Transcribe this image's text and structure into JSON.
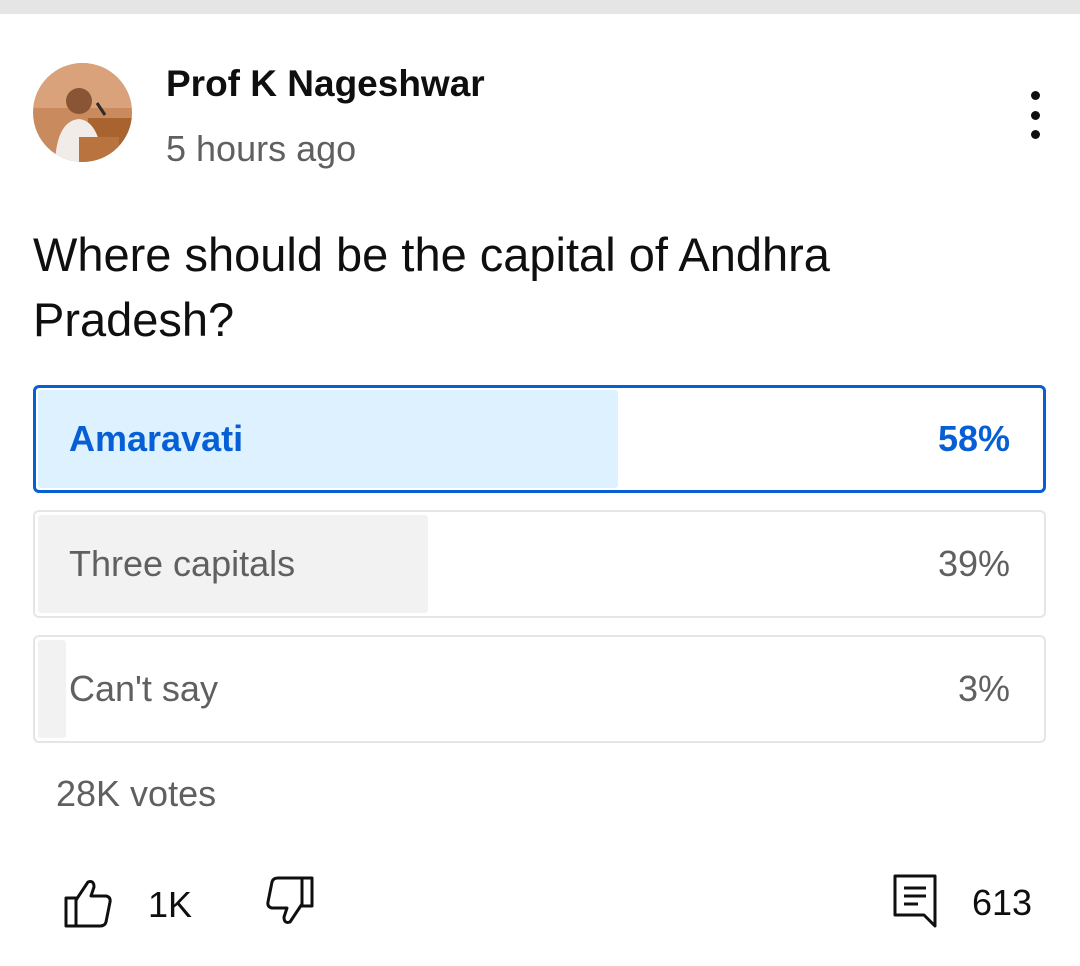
{
  "post": {
    "channel_name": "Prof K Nageshwar",
    "timestamp": "5 hours ago",
    "question": "Where should be the capital of Andhra Pradesh?"
  },
  "poll": {
    "options": [
      {
        "label": "Amaravati",
        "percent_text": "58%",
        "percent": 58,
        "selected": true
      },
      {
        "label": "Three capitals",
        "percent_text": "39%",
        "percent": 39,
        "selected": false
      },
      {
        "label": "Can't say",
        "percent_text": "3%",
        "percent": 3,
        "selected": false
      }
    ],
    "votes": "28K votes"
  },
  "actions": {
    "likes": "1K",
    "comments": "613"
  },
  "icons": {
    "more": "more-vert-icon",
    "like": "thumb-up-icon",
    "dislike": "thumb-down-icon",
    "comments": "comment-icon"
  },
  "colors": {
    "accent": "#065fd4",
    "selected_fill": "#def1ff",
    "unselected_fill": "#f2f2f2",
    "secondary_text": "#606060"
  }
}
